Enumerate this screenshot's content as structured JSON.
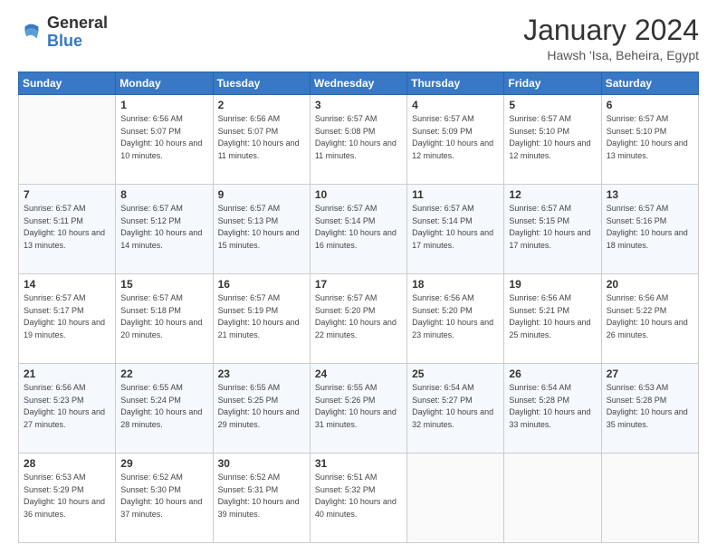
{
  "logo": {
    "line1": "General",
    "line2": "Blue"
  },
  "header": {
    "title": "January 2024",
    "subtitle": "Hawsh 'Isa, Beheira, Egypt"
  },
  "weekdays": [
    "Sunday",
    "Monday",
    "Tuesday",
    "Wednesday",
    "Thursday",
    "Friday",
    "Saturday"
  ],
  "weeks": [
    [
      {
        "day": "",
        "sunrise": "",
        "sunset": "",
        "daylight": ""
      },
      {
        "day": "1",
        "sunrise": "Sunrise: 6:56 AM",
        "sunset": "Sunset: 5:07 PM",
        "daylight": "Daylight: 10 hours and 10 minutes."
      },
      {
        "day": "2",
        "sunrise": "Sunrise: 6:56 AM",
        "sunset": "Sunset: 5:07 PM",
        "daylight": "Daylight: 10 hours and 11 minutes."
      },
      {
        "day": "3",
        "sunrise": "Sunrise: 6:57 AM",
        "sunset": "Sunset: 5:08 PM",
        "daylight": "Daylight: 10 hours and 11 minutes."
      },
      {
        "day": "4",
        "sunrise": "Sunrise: 6:57 AM",
        "sunset": "Sunset: 5:09 PM",
        "daylight": "Daylight: 10 hours and 12 minutes."
      },
      {
        "day": "5",
        "sunrise": "Sunrise: 6:57 AM",
        "sunset": "Sunset: 5:10 PM",
        "daylight": "Daylight: 10 hours and 12 minutes."
      },
      {
        "day": "6",
        "sunrise": "Sunrise: 6:57 AM",
        "sunset": "Sunset: 5:10 PM",
        "daylight": "Daylight: 10 hours and 13 minutes."
      }
    ],
    [
      {
        "day": "7",
        "sunrise": "Sunrise: 6:57 AM",
        "sunset": "Sunset: 5:11 PM",
        "daylight": "Daylight: 10 hours and 13 minutes."
      },
      {
        "day": "8",
        "sunrise": "Sunrise: 6:57 AM",
        "sunset": "Sunset: 5:12 PM",
        "daylight": "Daylight: 10 hours and 14 minutes."
      },
      {
        "day": "9",
        "sunrise": "Sunrise: 6:57 AM",
        "sunset": "Sunset: 5:13 PM",
        "daylight": "Daylight: 10 hours and 15 minutes."
      },
      {
        "day": "10",
        "sunrise": "Sunrise: 6:57 AM",
        "sunset": "Sunset: 5:14 PM",
        "daylight": "Daylight: 10 hours and 16 minutes."
      },
      {
        "day": "11",
        "sunrise": "Sunrise: 6:57 AM",
        "sunset": "Sunset: 5:14 PM",
        "daylight": "Daylight: 10 hours and 17 minutes."
      },
      {
        "day": "12",
        "sunrise": "Sunrise: 6:57 AM",
        "sunset": "Sunset: 5:15 PM",
        "daylight": "Daylight: 10 hours and 17 minutes."
      },
      {
        "day": "13",
        "sunrise": "Sunrise: 6:57 AM",
        "sunset": "Sunset: 5:16 PM",
        "daylight": "Daylight: 10 hours and 18 minutes."
      }
    ],
    [
      {
        "day": "14",
        "sunrise": "Sunrise: 6:57 AM",
        "sunset": "Sunset: 5:17 PM",
        "daylight": "Daylight: 10 hours and 19 minutes."
      },
      {
        "day": "15",
        "sunrise": "Sunrise: 6:57 AM",
        "sunset": "Sunset: 5:18 PM",
        "daylight": "Daylight: 10 hours and 20 minutes."
      },
      {
        "day": "16",
        "sunrise": "Sunrise: 6:57 AM",
        "sunset": "Sunset: 5:19 PM",
        "daylight": "Daylight: 10 hours and 21 minutes."
      },
      {
        "day": "17",
        "sunrise": "Sunrise: 6:57 AM",
        "sunset": "Sunset: 5:20 PM",
        "daylight": "Daylight: 10 hours and 22 minutes."
      },
      {
        "day": "18",
        "sunrise": "Sunrise: 6:56 AM",
        "sunset": "Sunset: 5:20 PM",
        "daylight": "Daylight: 10 hours and 23 minutes."
      },
      {
        "day": "19",
        "sunrise": "Sunrise: 6:56 AM",
        "sunset": "Sunset: 5:21 PM",
        "daylight": "Daylight: 10 hours and 25 minutes."
      },
      {
        "day": "20",
        "sunrise": "Sunrise: 6:56 AM",
        "sunset": "Sunset: 5:22 PM",
        "daylight": "Daylight: 10 hours and 26 minutes."
      }
    ],
    [
      {
        "day": "21",
        "sunrise": "Sunrise: 6:56 AM",
        "sunset": "Sunset: 5:23 PM",
        "daylight": "Daylight: 10 hours and 27 minutes."
      },
      {
        "day": "22",
        "sunrise": "Sunrise: 6:55 AM",
        "sunset": "Sunset: 5:24 PM",
        "daylight": "Daylight: 10 hours and 28 minutes."
      },
      {
        "day": "23",
        "sunrise": "Sunrise: 6:55 AM",
        "sunset": "Sunset: 5:25 PM",
        "daylight": "Daylight: 10 hours and 29 minutes."
      },
      {
        "day": "24",
        "sunrise": "Sunrise: 6:55 AM",
        "sunset": "Sunset: 5:26 PM",
        "daylight": "Daylight: 10 hours and 31 minutes."
      },
      {
        "day": "25",
        "sunrise": "Sunrise: 6:54 AM",
        "sunset": "Sunset: 5:27 PM",
        "daylight": "Daylight: 10 hours and 32 minutes."
      },
      {
        "day": "26",
        "sunrise": "Sunrise: 6:54 AM",
        "sunset": "Sunset: 5:28 PM",
        "daylight": "Daylight: 10 hours and 33 minutes."
      },
      {
        "day": "27",
        "sunrise": "Sunrise: 6:53 AM",
        "sunset": "Sunset: 5:28 PM",
        "daylight": "Daylight: 10 hours and 35 minutes."
      }
    ],
    [
      {
        "day": "28",
        "sunrise": "Sunrise: 6:53 AM",
        "sunset": "Sunset: 5:29 PM",
        "daylight": "Daylight: 10 hours and 36 minutes."
      },
      {
        "day": "29",
        "sunrise": "Sunrise: 6:52 AM",
        "sunset": "Sunset: 5:30 PM",
        "daylight": "Daylight: 10 hours and 37 minutes."
      },
      {
        "day": "30",
        "sunrise": "Sunrise: 6:52 AM",
        "sunset": "Sunset: 5:31 PM",
        "daylight": "Daylight: 10 hours and 39 minutes."
      },
      {
        "day": "31",
        "sunrise": "Sunrise: 6:51 AM",
        "sunset": "Sunset: 5:32 PM",
        "daylight": "Daylight: 10 hours and 40 minutes."
      },
      {
        "day": "",
        "sunrise": "",
        "sunset": "",
        "daylight": ""
      },
      {
        "day": "",
        "sunrise": "",
        "sunset": "",
        "daylight": ""
      },
      {
        "day": "",
        "sunrise": "",
        "sunset": "",
        "daylight": ""
      }
    ]
  ]
}
